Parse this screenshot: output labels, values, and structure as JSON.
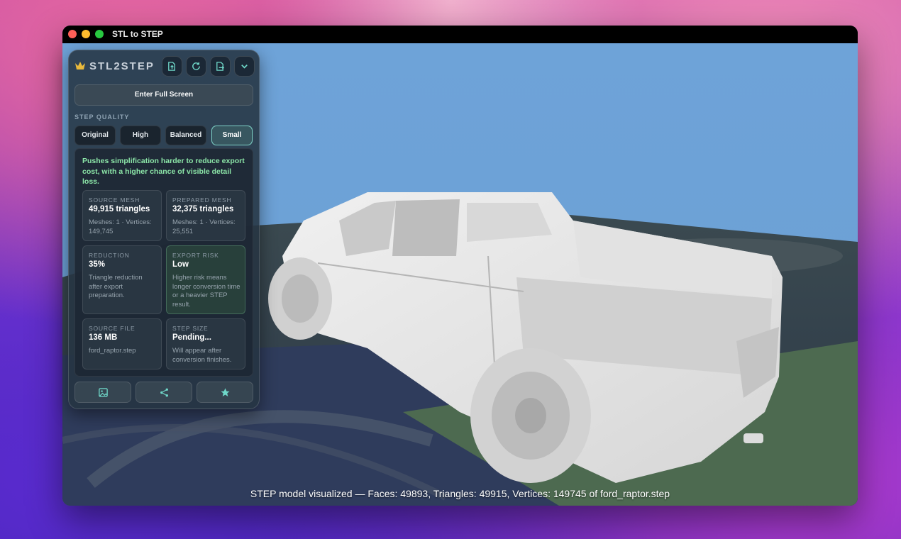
{
  "window": {
    "title": "STL to STEP"
  },
  "panel": {
    "brand": "STL2STEP",
    "toolbar": [
      {
        "name": "import-mesh-button",
        "icon": "file-upload-icon"
      },
      {
        "name": "refresh-button",
        "icon": "refresh-icon"
      },
      {
        "name": "export-step-button",
        "icon": "export-icon"
      },
      {
        "name": "collapse-button",
        "icon": "chevron-down-icon"
      }
    ],
    "fullscreen_label": "Enter Full Screen",
    "quality_label": "STEP QUALITY",
    "quality_options": [
      "Original",
      "High",
      "Balanced",
      "Small"
    ],
    "quality_selected": "Small",
    "description": "Pushes simplification harder to reduce export cost, with a higher chance of visible detail loss.",
    "stats": {
      "source_mesh": {
        "label": "SOURCE MESH",
        "value": "49,915 triangles",
        "sub": "Meshes: 1 · Vertices: 149,745"
      },
      "prepared_mesh": {
        "label": "PREPARED MESH",
        "value": "32,375 triangles",
        "sub": "Meshes: 1 · Vertices: 25,551"
      },
      "reduction": {
        "label": "REDUCTION",
        "value": "35%",
        "sub": "Triangle reduction after export preparation."
      },
      "export_risk": {
        "label": "EXPORT RISK",
        "value": "Low",
        "sub": "Higher risk means longer conversion time or a heavier STEP result."
      },
      "source_file": {
        "label": "SOURCE FILE",
        "value": "136 MB",
        "sub": "ford_raptor.step"
      },
      "step_size": {
        "label": "STEP SIZE",
        "value": "Pending...",
        "sub": "Will appear after conversion finishes."
      }
    },
    "bottom_buttons": [
      {
        "name": "image-button",
        "icon": "image-icon"
      },
      {
        "name": "share-button",
        "icon": "share-icon"
      },
      {
        "name": "favorite-button",
        "icon": "star-icon"
      }
    ]
  },
  "viewport": {
    "status": "STEP model visualized — Faces: 49893, Triangles: 49915, Vertices: 149745 of ford_raptor.step"
  },
  "colors": {
    "accent": "#7fd3c8",
    "positive": "#8ce6a8",
    "sky": "#6ea3d8"
  }
}
